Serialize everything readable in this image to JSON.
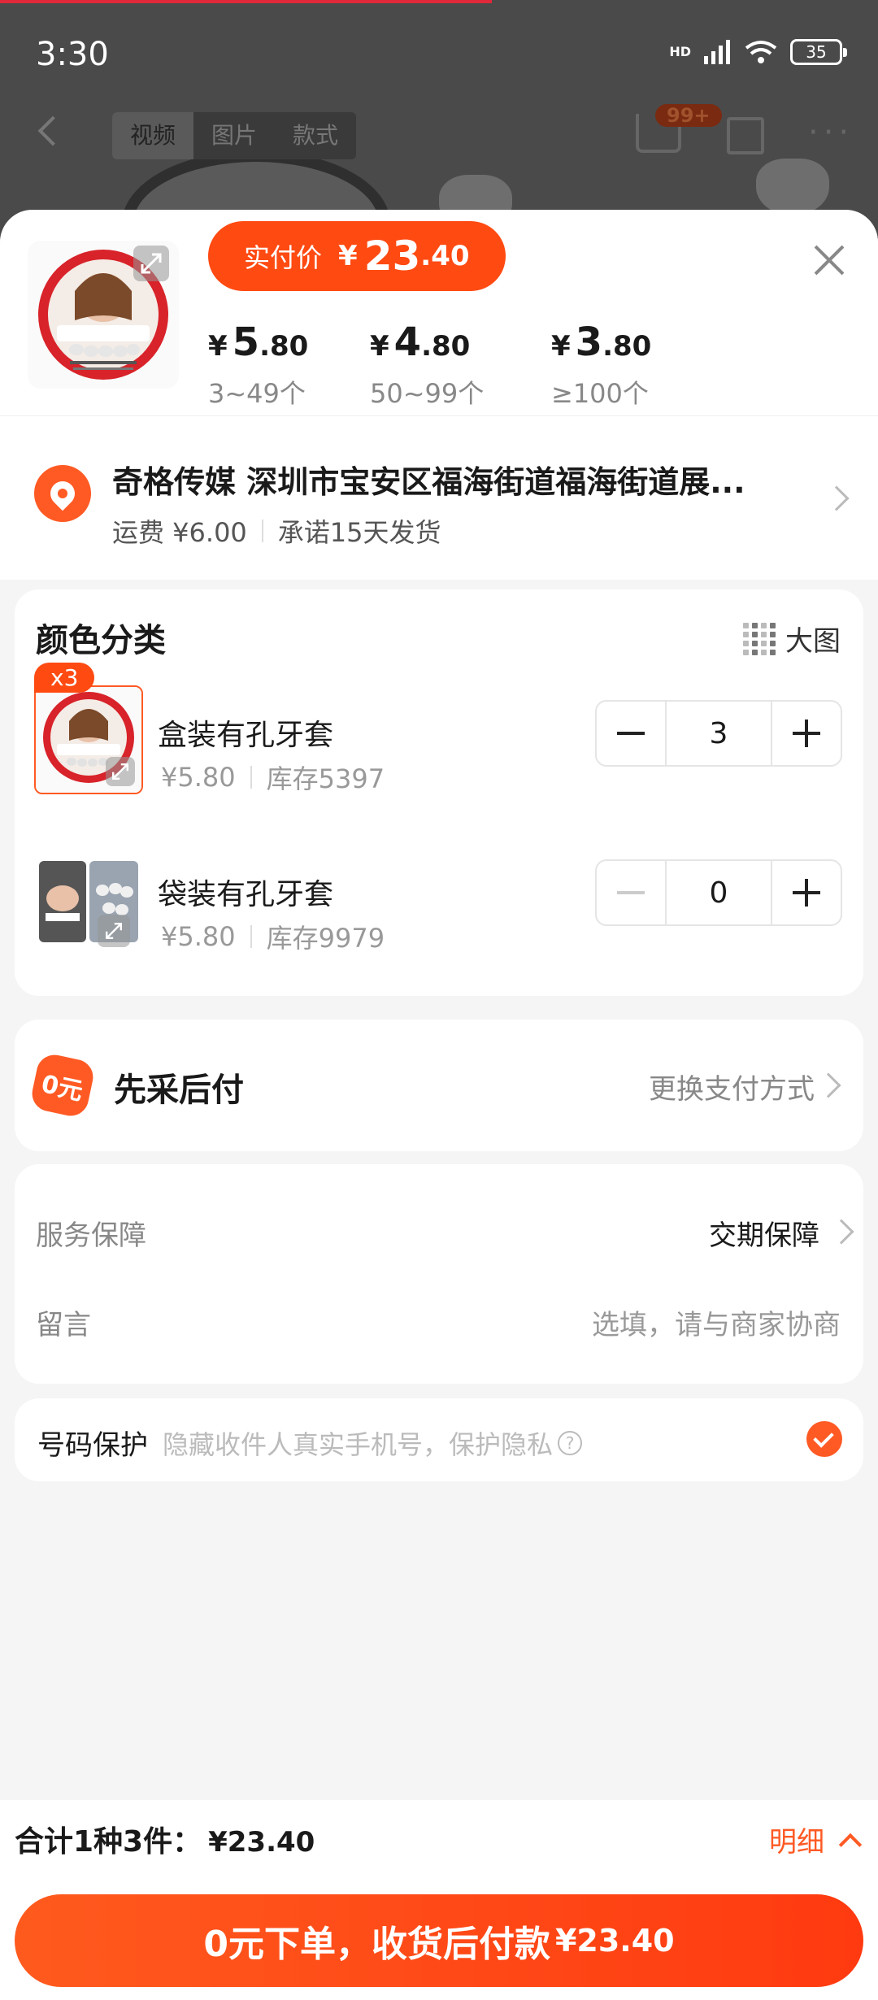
{
  "status_bar": {
    "time": "3:30",
    "network_label": "HD",
    "battery": "35"
  },
  "background_page": {
    "tabs": [
      "视频",
      "图片",
      "款式"
    ],
    "cart_badge": "99+"
  },
  "price_header": {
    "pill_label": "实付价",
    "currency": "¥",
    "pill_int": "23",
    "pill_dec": ".40",
    "tiers": [
      {
        "currency": "¥",
        "int": "5",
        "dec": ".80",
        "qty": "3~49个"
      },
      {
        "currency": "¥",
        "int": "4",
        "dec": ".80",
        "qty": "50~99个"
      },
      {
        "currency": "¥",
        "int": "3",
        "dec": ".80",
        "qty": "≥100个"
      }
    ]
  },
  "address": {
    "line": "奇格传媒 深圳市宝安区福海街道福海街道展...",
    "shipping": "运费 ¥6.00",
    "promise": "承诺15天发货"
  },
  "color_section": {
    "title": "颜色分类",
    "big_image_label": "大图",
    "selected_badge": "x3",
    "items": [
      {
        "name": "盒装有孔牙套",
        "price": "¥5.80",
        "stock": "库存5397",
        "qty": "3"
      },
      {
        "name": "袋装有孔牙套",
        "price": "¥5.80",
        "stock": "库存9979",
        "qty": "0"
      }
    ]
  },
  "payment": {
    "icon_text": "0元",
    "title": "先采后付",
    "change_label": "更换支付方式"
  },
  "service": {
    "guarantee_label": "服务保障",
    "guarantee_value": "交期保障",
    "message_label": "留言",
    "message_placeholder": "选填，请与商家协商"
  },
  "privacy": {
    "label": "号码保护",
    "desc": "隐藏收件人真实手机号，保护隐私",
    "qmark": "?"
  },
  "footer": {
    "total_label": "合计1种3件：",
    "total_amount": "¥23.40",
    "detail_label": "明细",
    "cta_label": "0元下单，收货后付款",
    "cta_amount": "¥23.40"
  },
  "colors": {
    "accent": "#ff4a12",
    "text": "#1a1a1a",
    "muted": "#888888"
  }
}
